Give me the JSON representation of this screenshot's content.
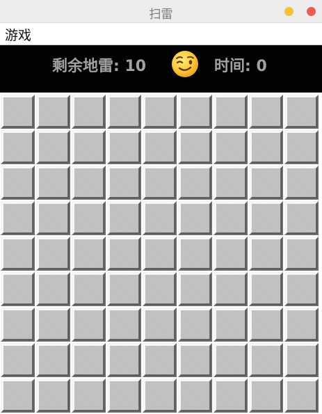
{
  "window": {
    "title": "扫雷"
  },
  "menu": {
    "items": [
      {
        "label": "游戏"
      }
    ]
  },
  "status": {
    "mines_label": "剩余地雷: 10",
    "face": "winking-face-icon",
    "timer_label": "时间: 0"
  },
  "board": {
    "rows": 9,
    "cols": 9,
    "state": "all-covered"
  },
  "colors": {
    "status_bg": "#020202",
    "status_text": "#a2a2a2",
    "cell_face": "#c6c6c6",
    "cell_highlight": "#f4f4f4",
    "cell_shadow": "#6e6e6e",
    "close_button": "#ed5b56",
    "minimize_button": "#f3c135"
  }
}
